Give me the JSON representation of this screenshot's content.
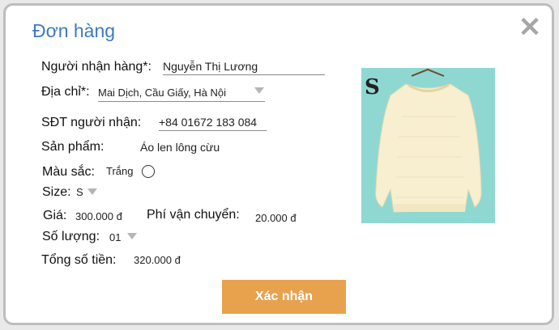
{
  "dialog": {
    "title": "Đơn hàng",
    "close_icon": "close-icon"
  },
  "form": {
    "recipient": {
      "label": "Người nhận hàng*:",
      "value": "Nguyễn Thị Lương"
    },
    "address": {
      "label": "Địa chỉ*:",
      "value": "Mai Dịch, Cầu Giấy, Hà Nội"
    },
    "phone": {
      "label": "SĐT người nhận:",
      "value": "+84 01672 183 084"
    },
    "product": {
      "label": "Sản phẩm:",
      "value": "Áo len lông cừu"
    },
    "color": {
      "label": "Màu sắc:",
      "value": "Trắng"
    },
    "size": {
      "label": "Size:",
      "value": "S"
    },
    "price": {
      "label": "Giá:",
      "value": "300.000 đ"
    },
    "shipping": {
      "label": "Phí vận chuyển:",
      "value": "20.000 đ"
    },
    "quantity": {
      "label": "Số lượng:",
      "value": "01"
    },
    "total": {
      "label": "Tổng số tiền:",
      "value": "320.000 đ"
    }
  },
  "product_image": {
    "icon": "sweater-product-image",
    "background": "#8fd8d2",
    "garment_color": "#f7efcf"
  },
  "actions": {
    "confirm_label": "Xác nhận",
    "confirm_color": "#e8a24e"
  }
}
